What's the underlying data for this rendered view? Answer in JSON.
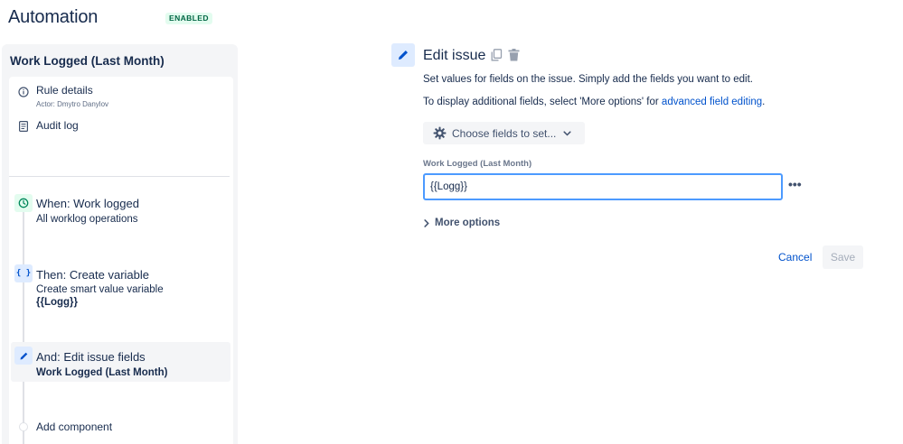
{
  "header": {
    "title": "Automation",
    "status_badge": "ENABLED"
  },
  "sidebar": {
    "rule_name": "Work Logged (Last Month)",
    "rule_details": {
      "label": "Rule details",
      "actor": "Actor: Dmytro Danylov"
    },
    "audit_log": {
      "label": "Audit log"
    },
    "steps": [
      {
        "title": "When: Work logged",
        "description": "All worklog operations",
        "type": "trigger"
      },
      {
        "title": "Then: Create variable",
        "description": "Create smart value variable",
        "detail": "{{Logg}}",
        "type": "action"
      },
      {
        "title": "And: Edit issue fields",
        "detail": "Work Logged (Last Month)",
        "type": "action",
        "selected": true
      }
    ],
    "add_component": "Add component"
  },
  "main": {
    "title": "Edit issue",
    "description": "Set values for fields on the issue. Simply add the fields you want to edit.",
    "additional_prefix": "To display additional fields, select 'More options' for ",
    "additional_link": "advanced field editing",
    "additional_suffix": ".",
    "choose_fields_label": "Choose fields to set...",
    "field": {
      "label": "Work Logged (Last Month)",
      "value": "{{Logg}}"
    },
    "more_dots": "•••",
    "more_options_label": "More options",
    "cancel_label": "Cancel",
    "save_label": "Save"
  },
  "colors": {
    "accent": "#0052cc",
    "badge_bg": "#e3fcef",
    "badge_text": "#006644",
    "focus_border": "#4c9aff"
  }
}
